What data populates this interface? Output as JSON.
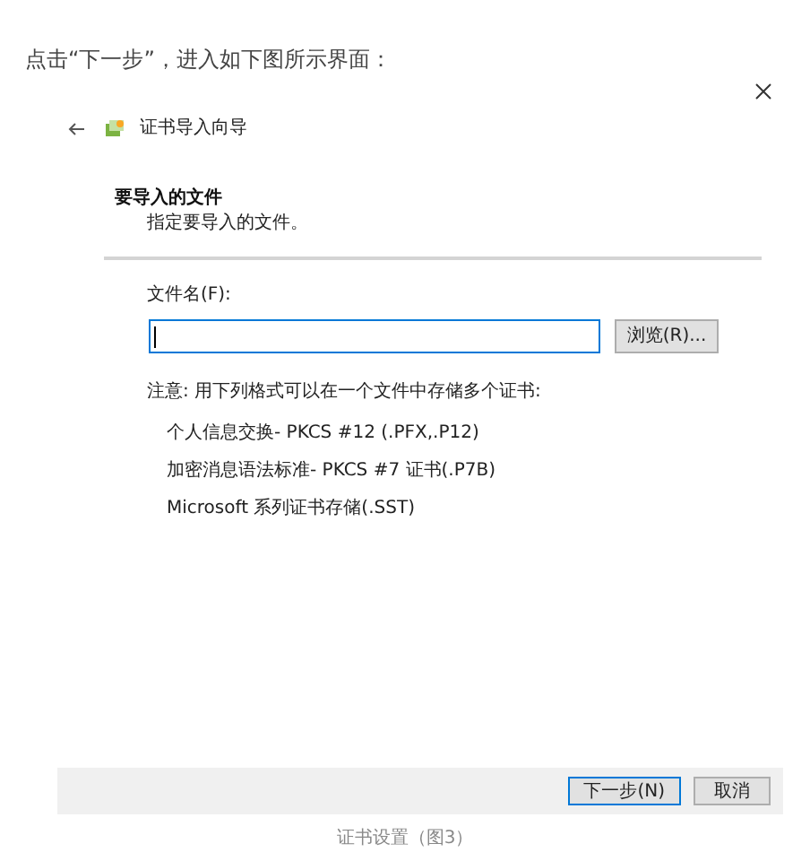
{
  "intro": "点击“下一步”，进入如下图所示界面：",
  "dialog": {
    "title": "证书导入向导",
    "section": {
      "heading": "要导入的文件",
      "description": "指定要导入的文件。"
    },
    "file_field": {
      "label": "文件名(F):",
      "focused": true
    },
    "browse_button": "浏览(R)...",
    "note": "注意: 用下列格式可以在一个文件中存储多个证书:",
    "formats": [
      "个人信息交换- PKCS #12 (.PFX,.P12)",
      "加密消息语法标准- PKCS #7 证书(.P7B)",
      "Microsoft 系列证书存储(.SST)"
    ],
    "buttons": [
      {
        "label": "下一步(N)",
        "default": true
      },
      {
        "label": "取消",
        "default": false
      }
    ]
  },
  "caption": "证书设置（图3）"
}
